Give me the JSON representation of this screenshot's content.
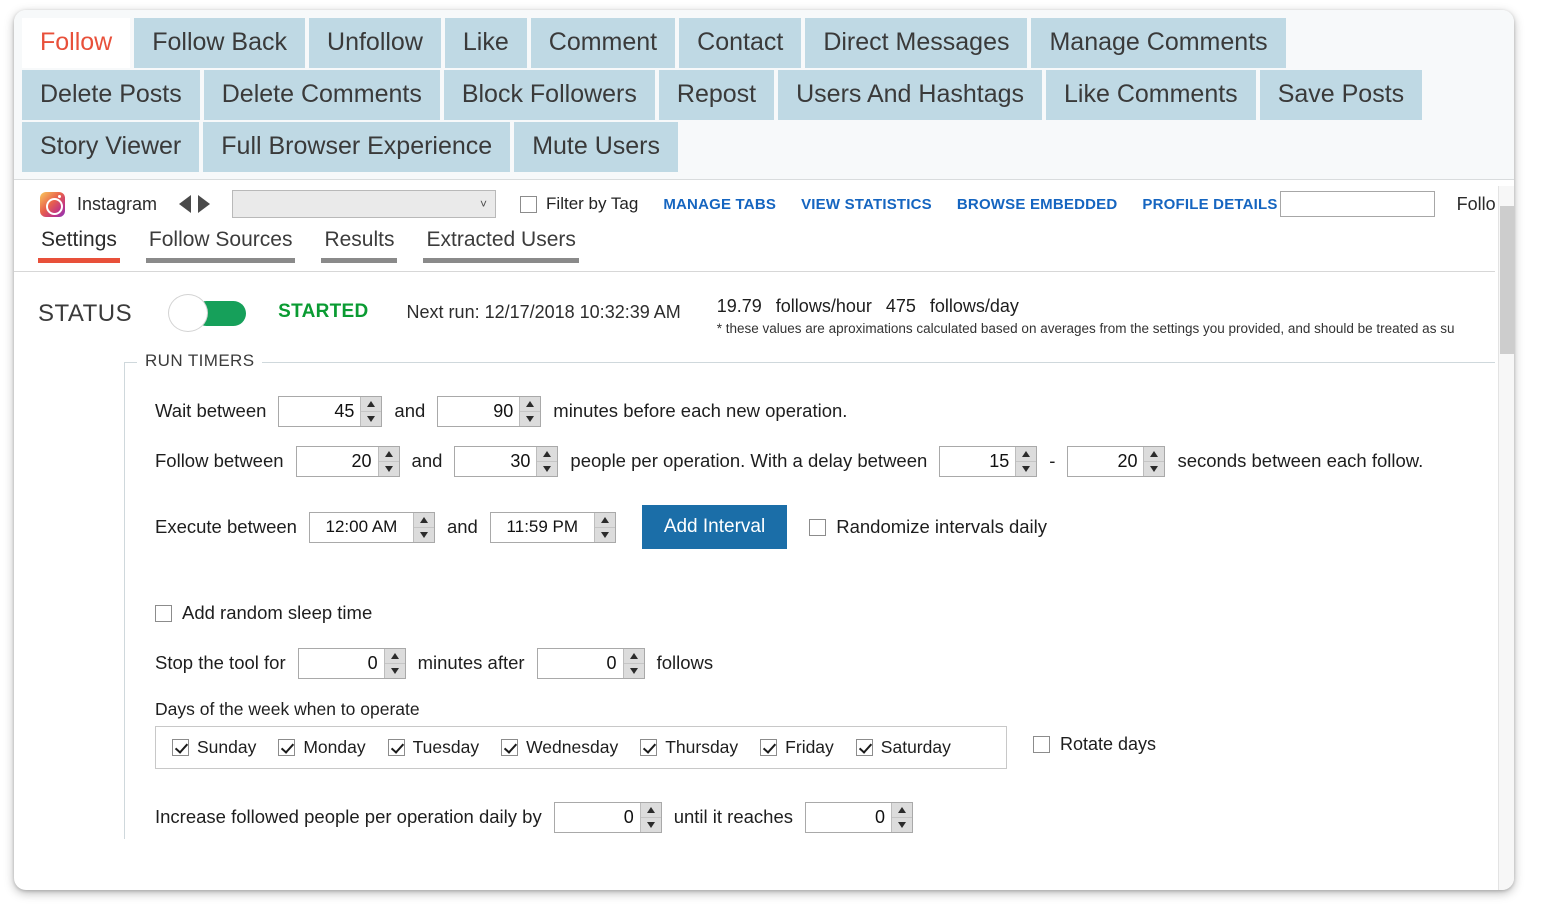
{
  "window": {
    "title": "Follow"
  },
  "top_tabs": {
    "rows": [
      [
        {
          "label": "Follow",
          "active": true
        },
        {
          "label": "Follow Back",
          "active": false
        },
        {
          "label": "Unfollow",
          "active": false
        },
        {
          "label": "Like",
          "active": false
        },
        {
          "label": "Comment",
          "active": false
        },
        {
          "label": "Contact",
          "active": false
        },
        {
          "label": "Direct Messages",
          "active": false
        },
        {
          "label": "Manage Comments",
          "active": false
        }
      ],
      [
        {
          "label": "Delete Posts",
          "active": false
        },
        {
          "label": "Delete Comments",
          "active": false
        },
        {
          "label": "Block Followers",
          "active": false
        },
        {
          "label": "Repost",
          "active": false
        },
        {
          "label": "Users And Hashtags",
          "active": false
        },
        {
          "label": "Like Comments",
          "active": false
        },
        {
          "label": "Save Posts",
          "active": false
        }
      ],
      [
        {
          "label": "Story Viewer",
          "active": false
        },
        {
          "label": "Full Browser Experience",
          "active": false
        },
        {
          "label": "Mute Users",
          "active": false
        }
      ]
    ]
  },
  "toolbar": {
    "platform_icon": "instagram-icon",
    "platform_label": "Instagram",
    "prev_icon": "triangle-left-icon",
    "next_icon": "triangle-right-icon",
    "account_select_value": "",
    "account_select_chevron": "˅",
    "filter_by_tag_label": "Filter by Tag",
    "filter_by_tag_checked": false,
    "links": [
      "MANAGE TABS",
      "VIEW STATISTICS",
      "BROWSE EMBEDDED",
      "PROFILE DETAILS"
    ],
    "profile_details_value": "",
    "profile_details_placeholder": "",
    "trailing_text": "Follo"
  },
  "subtabs": [
    {
      "label": "Settings",
      "active": true
    },
    {
      "label": "Follow Sources",
      "active": false
    },
    {
      "label": "Results",
      "active": false
    },
    {
      "label": "Extracted Users",
      "active": false
    }
  ],
  "status": {
    "label": "STATUS",
    "toggle_on": true,
    "state_text": "STARTED",
    "state_color": "#0a9b32",
    "next_run": "Next run: 12/17/2018 10:32:39 AM",
    "rate_hour": "19.79",
    "rate_hour_unit": "follows/hour",
    "rate_day": "475",
    "rate_day_unit": "follows/day",
    "note": "* these values are aproximations calculated based on averages from the settings you provided, and should be treated as su"
  },
  "run_timers": {
    "legend": "RUN TIMERS",
    "wait": {
      "prefix": "Wait between",
      "min": "45",
      "joiner": "and",
      "max": "90",
      "suffix": "minutes before each new operation."
    },
    "follow": {
      "prefix": "Follow between",
      "min": "20",
      "joiner": "and",
      "max": "30",
      "mid": "people per operation. With a delay between",
      "delay_min": "15",
      "delay_joiner": "-",
      "delay_max": "20",
      "suffix": "seconds between each follow."
    },
    "execute": {
      "prefix": "Execute between",
      "start": "12:00 AM",
      "joiner": "and",
      "end": "11:59 PM",
      "add_interval_button": "Add Interval",
      "randomize_label": "Randomize intervals daily",
      "randomize_checked": false
    },
    "sleep": {
      "random_sleep_label": "Add random sleep time",
      "random_sleep_checked": false,
      "stop_prefix": "Stop the tool for",
      "stop_minutes": "0",
      "stop_mid": "minutes after",
      "stop_follows": "0",
      "stop_suffix": "follows"
    },
    "days": {
      "label": "Days of the week when to operate",
      "items": [
        {
          "label": "Sunday",
          "checked": true
        },
        {
          "label": "Monday",
          "checked": true
        },
        {
          "label": "Tuesday",
          "checked": true
        },
        {
          "label": "Wednesday",
          "checked": true
        },
        {
          "label": "Thursday",
          "checked": true
        },
        {
          "label": "Friday",
          "checked": true
        },
        {
          "label": "Saturday",
          "checked": true
        }
      ],
      "rotate_label": "Rotate days",
      "rotate_checked": false
    },
    "increase": {
      "prefix": "Increase followed people per operation daily by",
      "amount": "0",
      "mid": "until it reaches",
      "limit": "0"
    }
  },
  "colors": {
    "tab_inactive_bg": "#bfd9e4",
    "tab_active_text": "#e8503a",
    "link_blue": "#1565c0",
    "button_blue": "#1b6ea8",
    "status_green": "#0a9b32",
    "toggle_green": "#16a05a"
  }
}
